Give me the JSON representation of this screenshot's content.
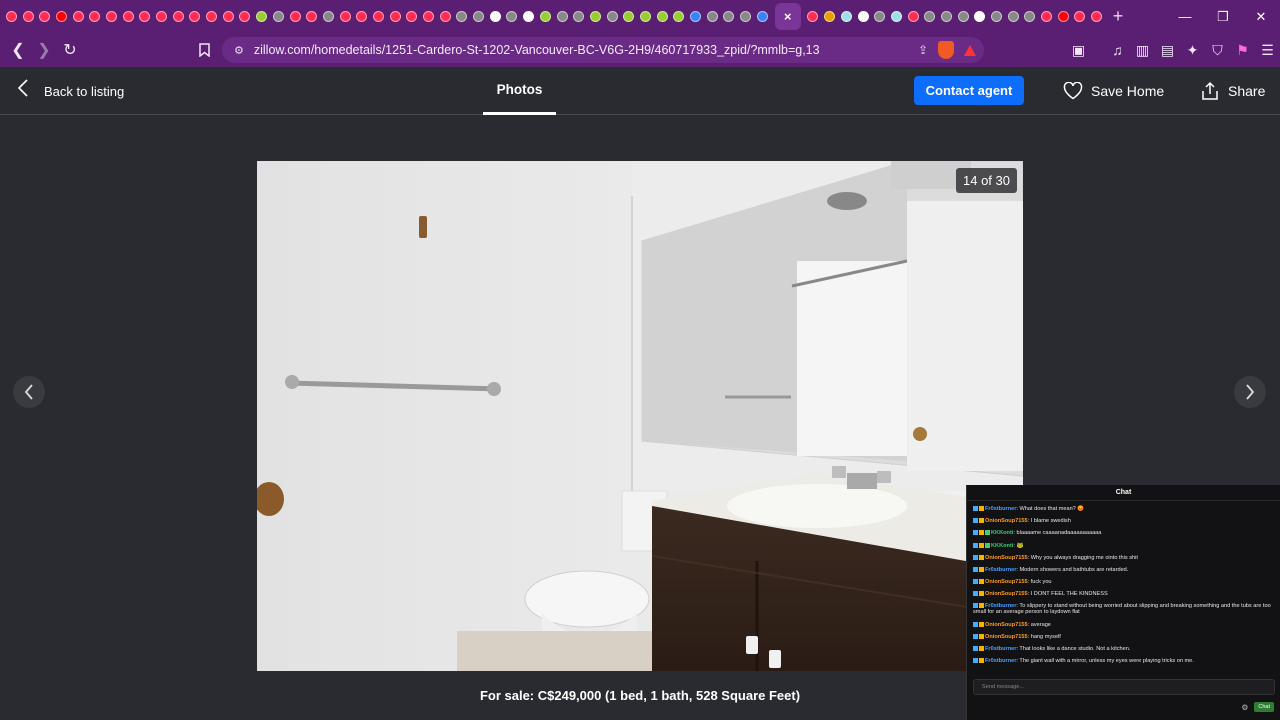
{
  "browser": {
    "tab_favicon_colors": [
      "#ff2d55",
      "#ff2d55",
      "#ff2d55",
      "#ff0000",
      "#ff2d55",
      "#ff2d55",
      "#ff2d55",
      "#ff2d55",
      "#ff2d55",
      "#ff2d55",
      "#ff2d55",
      "#ff2d55",
      "#ff2d55",
      "#ff2d55",
      "#ff2d55",
      "#9acd32",
      "#888888",
      "#ff2d55",
      "#ff2d55",
      "#888888",
      "#ff2d55",
      "#ff2d55",
      "#ff2d55",
      "#ff2d55",
      "#ff2d55",
      "#ff2d55",
      "#ff2d55",
      "#888888",
      "#888888",
      "#ffffff",
      "#888888",
      "#ffffff",
      "#9acd32",
      "#888888",
      "#888888",
      "#9acd32",
      "#888888",
      "#9acd32",
      "#9acd32",
      "#9acd32",
      "#9acd32",
      "#3b82f6",
      "#888888",
      "#888888",
      "#888888",
      "#3b82f6"
    ],
    "active_tab_label": "×",
    "tabs_after_active_colors": [
      "#ff2d55",
      "#e8a000",
      "#9fe0e8",
      "#ffffff",
      "#888888",
      "#9fe0e8",
      "#ff2d55",
      "#888888",
      "#888888",
      "#888888",
      "#ffffff",
      "#888888",
      "#888888",
      "#888888",
      "#ff2d55",
      "#ff0000",
      "#ff2d55",
      "#ff2d55"
    ],
    "url": "zillow.com/homedetails/1251-Cardero-St-1202-Vancouver-BC-V6G-2H9/460717933_zpid/?mmlb=g,13",
    "accent": "#5a1f73"
  },
  "header": {
    "back_label": "Back to listing",
    "photos_tab": "Photos",
    "contact_label": "Contact agent",
    "save_label": "Save Home",
    "share_label": "Share"
  },
  "viewer": {
    "counter": "14 of 30",
    "caption": "For sale: C$249,000 (1 bed, 1 bath, 528 Square Feet)",
    "current_photo": 14,
    "total_photos": 30
  },
  "chat": {
    "title": "Chat",
    "input_placeholder": "Send message...",
    "send_label": "Chat",
    "messages": [
      {
        "user": "Fr0stburner",
        "color": "#4aa3ff",
        "text": "What does that mean? 😡"
      },
      {
        "user": "OnionSoup7155",
        "color": "#ff9f1a",
        "text": "I blame swedish"
      },
      {
        "user": "KKKonti",
        "color": "#3bd16f",
        "text": "blaaaame caaaanadaaaaaaaaaaa"
      },
      {
        "user": "KKKonti",
        "color": "#3bd16f",
        "text": "🐸"
      },
      {
        "user": "OnionSoup7155",
        "color": "#ff9f1a",
        "text": "Why you always dragging me ointo this shit"
      },
      {
        "user": "Fr0stburner",
        "color": "#4aa3ff",
        "text": "Modern showers and bathtubs are retarded."
      },
      {
        "user": "OnionSoup7155",
        "color": "#ff9f1a",
        "text": "fuck you"
      },
      {
        "user": "OnionSoup7155",
        "color": "#ff9f1a",
        "text": "I DONT FEEL THE KINDNESS"
      },
      {
        "user": "Fr0stburner",
        "color": "#4aa3ff",
        "text": "To slippery to stand without being worried about slipping and breaking something and the tubs are too small for an average person to laydown flat",
        "wrap": true
      },
      {
        "user": "OnionSoup7155",
        "color": "#ff9f1a",
        "text": "average"
      },
      {
        "user": "OnionSoup7155",
        "color": "#ff9f1a",
        "text": "hang myself"
      },
      {
        "user": "Fr0stburner",
        "color": "#4aa3ff",
        "text": "That looks like a dance studio. Not a kitchen."
      },
      {
        "user": "Fr0stburner",
        "color": "#4aa3ff",
        "text": "The giant wall with a mirror, unless my eyes were playing tricks on me."
      }
    ]
  }
}
